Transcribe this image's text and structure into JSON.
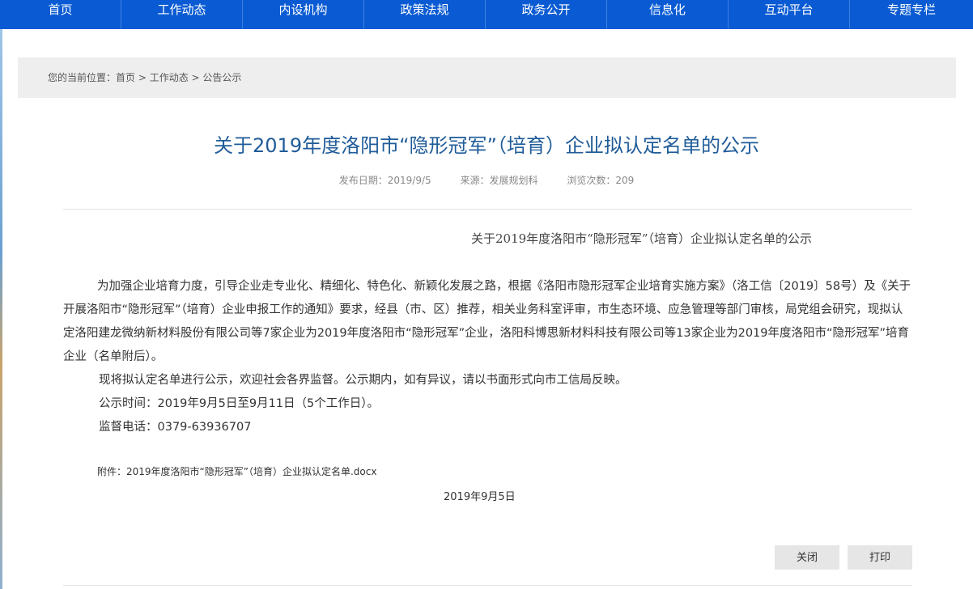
{
  "nav": {
    "items": [
      "首页",
      "工作动态",
      "内设机构",
      "政策法规",
      "政务公开",
      "信息化",
      "互动平台",
      "专题专栏"
    ]
  },
  "breadcrumb": {
    "prefix": "您的当前位置：",
    "home": "首页",
    "sep1": " > ",
    "section": "工作动态",
    "sep2": " > ",
    "current": "公告公示"
  },
  "article": {
    "title": "关于2019年度洛阳市“隐形冠军”（培育）企业拟认定名单的公示",
    "publish_date": "发布日期：2019/9/5",
    "source": "来源：发展规划科",
    "views": "浏览次数：209",
    "subtitle": "关于2019年度洛阳市“隐形冠军”（培育）企业拟认定名单的公示",
    "para1": "为加强企业培育力度，引导企业走专业化、精细化、特色化、新颖化发展之路，根据《洛阳市隐形冠军企业培育实施方案》（洛工信〔2019〕58号）及《关于开展洛阳市“隐形冠军”（培育）企业申报工作的通知》要求，经县（市、区）推荐，相关业务科室评审，市生态环境、应急管理等部门审核，局党组会研究，现拟认定洛阳建龙微纳新材料股份有限公司等7家企业为2019年度洛阳市“隐形冠军”企业，洛阳科博思新材料科技有限公司等13家企业为2019年度洛阳市“隐形冠军”培育企业（名单附后）。",
    "para2": "现将拟认定名单进行公示，欢迎社会各界监督。公示期内，如有异议，请以书面形式向市工信局反映。",
    "para3": "公示时间：2019年9月5日至9月11日（5个工作日）。",
    "para4": "监督电话：0379-63936707",
    "attachment": "附件：2019年度洛阳市“隐形冠军”（培育）企业拟认定名单.docx",
    "date": "2019年9月5日"
  },
  "buttons": {
    "close": "关闭",
    "print": "打印"
  }
}
